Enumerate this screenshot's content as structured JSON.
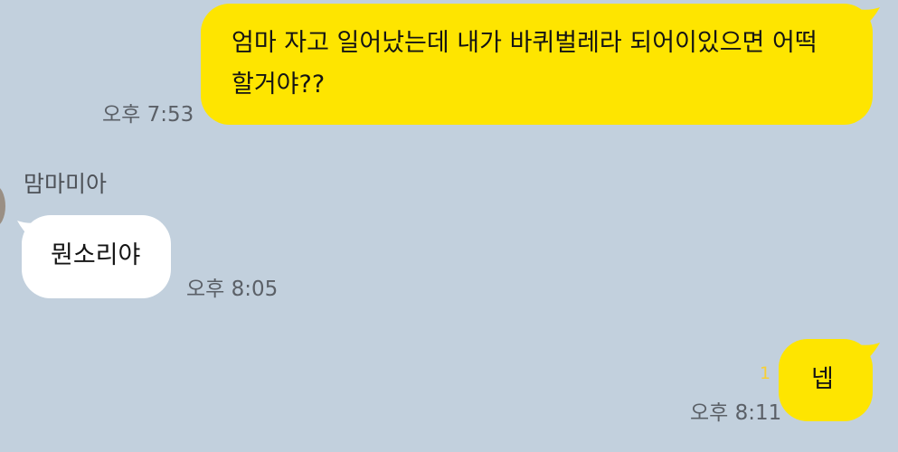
{
  "messages": [
    {
      "direction": "outgoing",
      "text": "엄마 자고 일어났는데 내가 바퀴벌레라 되어이있으면 어떡\n할거야??",
      "time": "오후 7:53"
    },
    {
      "direction": "incoming",
      "sender": "맘마미아",
      "text": "뭔소리야",
      "time": "오후 8:05"
    },
    {
      "direction": "outgoing",
      "text": "넵",
      "time": "오후 8:11",
      "unread_count": "1"
    }
  ],
  "colors": {
    "background": "#c2d0dd",
    "outgoing_bubble": "#fee500",
    "incoming_bubble": "#ffffff"
  }
}
